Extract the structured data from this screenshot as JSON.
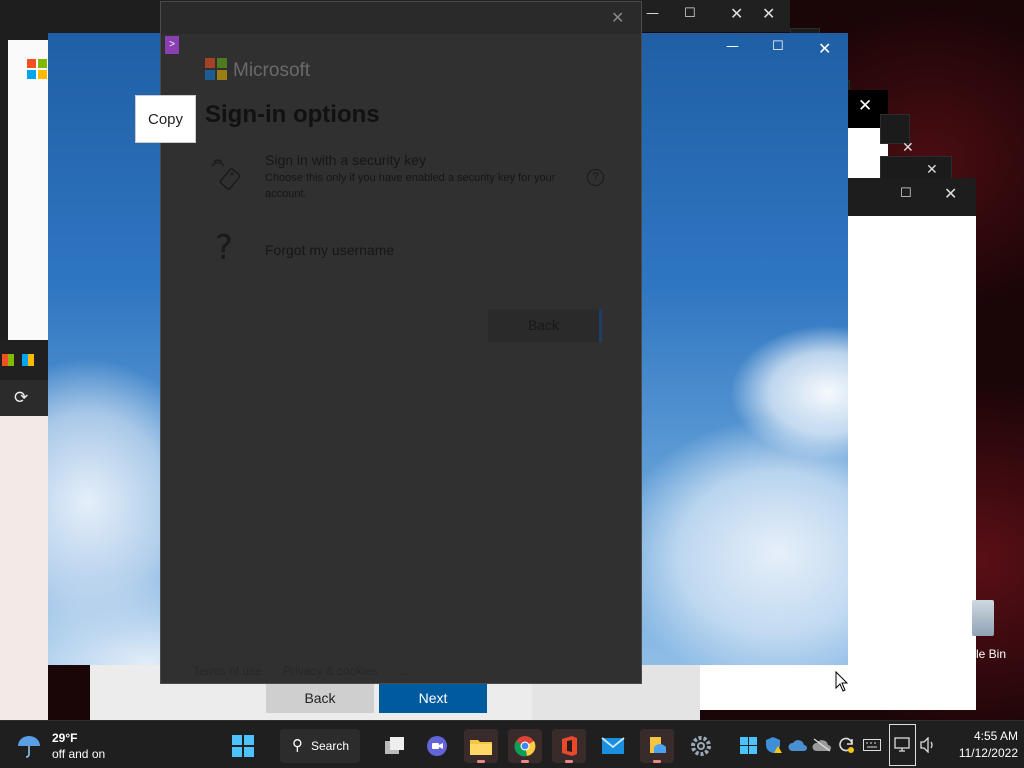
{
  "dialog": {
    "brand": "Microsoft",
    "title": "Sign-in options",
    "options": [
      {
        "title": "Sign in with a security key",
        "description": "Choose this only if you have enabled a security key for your account."
      },
      {
        "title": "Forgot my username"
      }
    ],
    "back_label": "Back",
    "footer": {
      "terms": "Terms of use",
      "privacy": "Privacy & cookies",
      "more": "..."
    }
  },
  "tooltip": {
    "copy": "Copy"
  },
  "wizard": {
    "back_label": "Back",
    "next_label": "Next"
  },
  "desktop": {
    "recycle_bin_label": "le Bin"
  },
  "taskbar": {
    "weather_temp": "29°F",
    "weather_desc": "off and on",
    "search_label": "Search",
    "time": "4:55 AM",
    "date": "11/12/2022"
  },
  "colors": {
    "accent_next": "#005a9e",
    "taskbar": "#1f1f1f"
  }
}
